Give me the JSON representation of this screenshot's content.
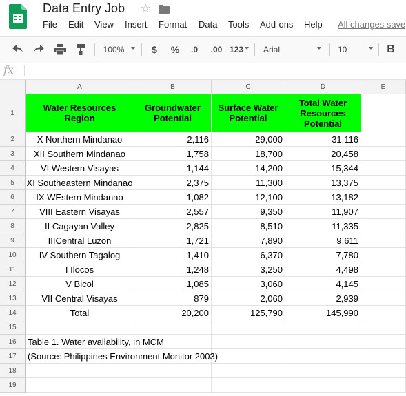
{
  "app": {
    "title": "Data Entry Job",
    "menu": [
      "File",
      "Edit",
      "View",
      "Insert",
      "Format",
      "Data",
      "Tools",
      "Add-ons",
      "Help"
    ],
    "save_status": "All changes save",
    "accent_color": "#0f9d58"
  },
  "toolbar": {
    "zoom": "100%",
    "currency": "$",
    "percent": "%",
    "decrease_decimals": ".0",
    "increase_decimals": ".00",
    "more_formats": "123",
    "font": "Arial",
    "font_size": "10",
    "bold": "B"
  },
  "formula_bar": {
    "fx": "fx",
    "value": ""
  },
  "columns": [
    "A",
    "B",
    "C",
    "D",
    "E"
  ],
  "rows": [
    "1",
    "2",
    "3",
    "4",
    "5",
    "6",
    "7",
    "8",
    "9",
    "10",
    "11",
    "12",
    "13",
    "14",
    "15",
    "16",
    "17",
    "18",
    "19"
  ],
  "table": {
    "header_color": "#00ff00",
    "headers": [
      [
        "Water Resources",
        "Region"
      ],
      [
        "Groundwater",
        "Potential"
      ],
      [
        "Surface Water",
        "Potential"
      ],
      [
        "Total Water",
        "Resources",
        "Potential"
      ]
    ],
    "data": [
      [
        "X Northern Mindanao",
        "2,116",
        "29,000",
        "31,116"
      ],
      [
        "XII Southern Mindanao",
        "1,758",
        "18,700",
        "20,458"
      ],
      [
        "VI Western Visayas",
        "1,144",
        "14,200",
        "15,344"
      ],
      [
        "XI Southeastern Mindanao",
        "2,375",
        "11,300",
        "13,375"
      ],
      [
        "IX WEstern Mindanao",
        "1,082",
        "12,100",
        "13,182"
      ],
      [
        "VIII Eastern Visayas",
        "2,557",
        "9,350",
        "11,907"
      ],
      [
        "II Cagayan Valley",
        "2,825",
        "8,510",
        "11,335"
      ],
      [
        "IIICentral Luzon",
        "1,721",
        "7,890",
        "9,611"
      ],
      [
        "IV Southern Tagalog",
        "1,410",
        "6,370",
        "7,780"
      ],
      [
        "I Ilocos",
        "1,248",
        "3,250",
        "4,498"
      ],
      [
        "V Bicol",
        "1,085",
        "3,060",
        "4,145"
      ],
      [
        "VII Central Visayas",
        "879",
        "2,060",
        "2,939"
      ],
      [
        "Total",
        "20,200",
        "125,790",
        "145,990"
      ]
    ]
  },
  "notes": [
    "Table 1. Water availability, in MCM",
    "(Source: Philippines Environment Monitor 2003)"
  ],
  "icons": [
    "sheets-logo-icon",
    "star-icon",
    "folder-icon",
    "undo-icon",
    "redo-icon",
    "print-icon",
    "paint-format-icon"
  ]
}
